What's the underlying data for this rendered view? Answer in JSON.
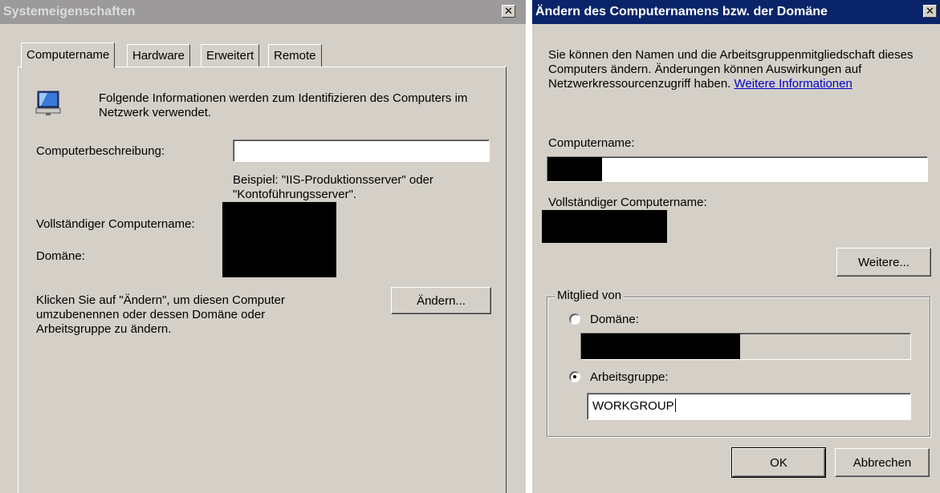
{
  "left_window": {
    "title": "Systemeigenschaften",
    "close_glyph": "✕",
    "tabs": [
      "Computername",
      "Hardware",
      "Erweitert",
      "Remote"
    ],
    "selected_tab": "Computername",
    "intro_text": "Folgende Informationen werden zum Identifizieren des Computers im Netzwerk verwendet.",
    "description_label": "Computerbeschreibung:",
    "description_value": "",
    "example_text": "Beispiel: \"IIS-Produktionsserver\" oder \"Kontoführungsserver\".",
    "full_name_label": "Vollständiger Computername:",
    "domain_label": "Domäne:",
    "change_text": "Klicken Sie auf \"Ändern\", um diesen Computer umzubenennen oder dessen Domäne oder Arbeitsgruppe zu ändern.",
    "change_button": "Ändern...",
    "icon": "computer-network-icon"
  },
  "right_window": {
    "title": "Ändern des Computernamens bzw. der Domäne",
    "close_glyph": "✕",
    "intro_text": "Sie können den Namen und die Arbeitsgruppenmitgliedschaft dieses Computers ändern. Änderungen können Auswirkungen auf Netzwerkressourcenzugriff haben.",
    "intro_link": "Weitere Informationen",
    "computer_name_label": "Computername:",
    "computer_name_value": "",
    "full_name_label": "Vollständiger Computername:",
    "more_button": "Weitere...",
    "member_group_label": "Mitglied von",
    "domain_radio_label": "Domäne:",
    "domain_value": "",
    "workgroup_radio_label": "Arbeitsgruppe:",
    "workgroup_value": "WORKGROUP",
    "selected_membership": "Arbeitsgruppe",
    "ok_button": "OK",
    "cancel_button": "Abbrechen"
  },
  "colors": {
    "dialog_face": "#d4d0c8",
    "active_title": "#0a246a",
    "inactive_title": "#9c9a9a",
    "link": "#0000cc",
    "redaction": "#000000"
  }
}
